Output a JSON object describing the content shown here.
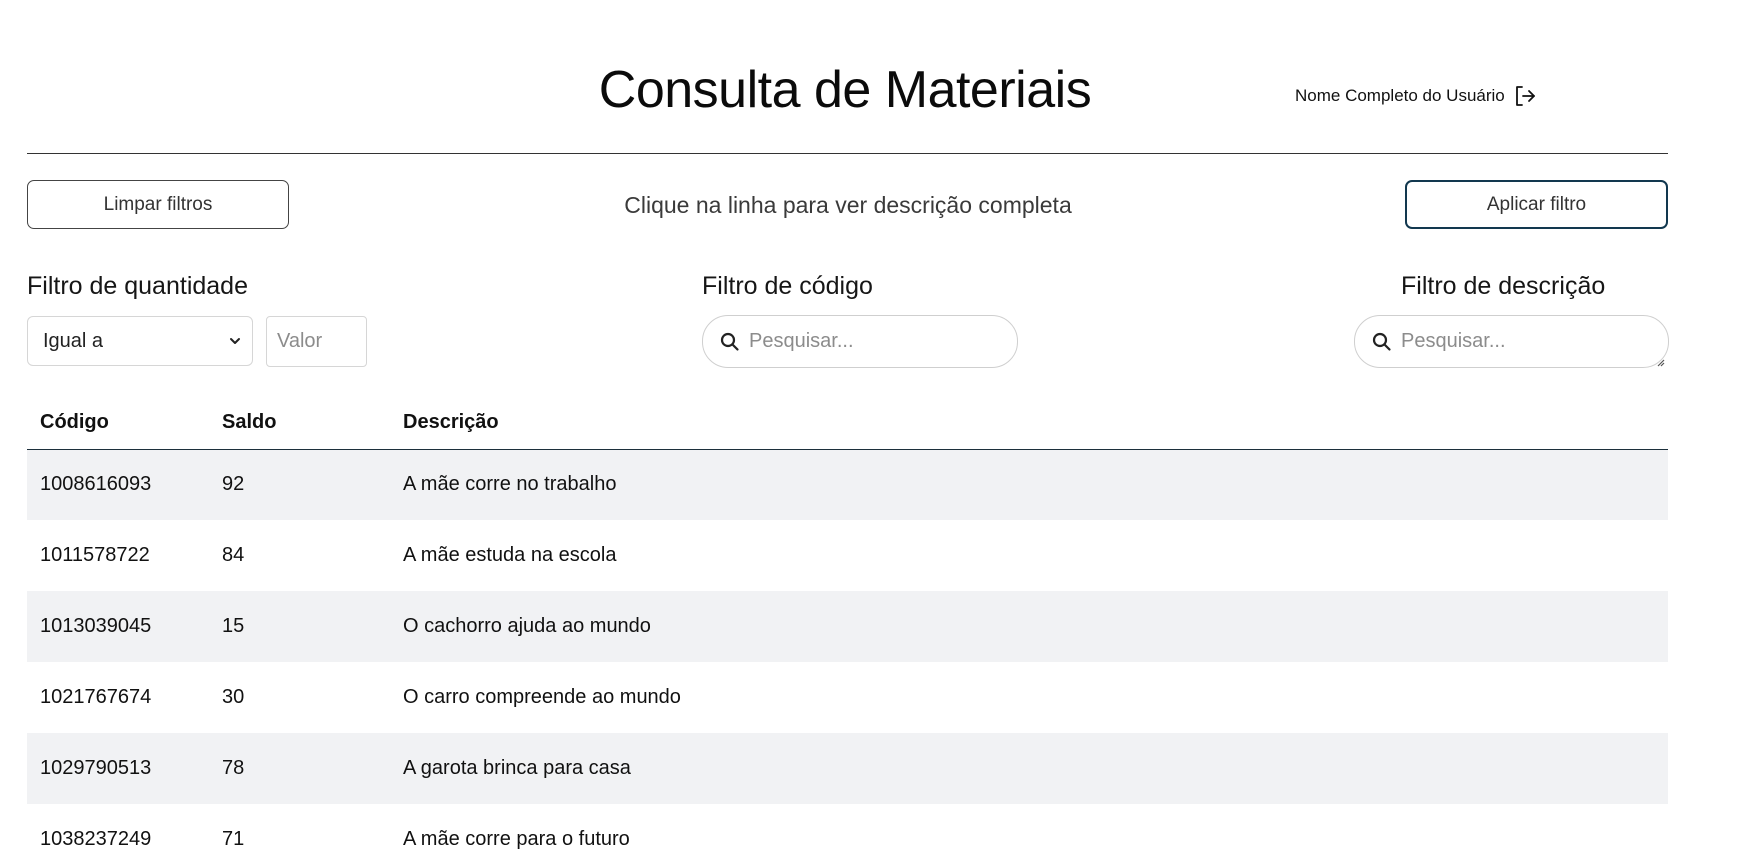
{
  "header": {
    "title": "Consulta de Materiais",
    "user_name": "Nome Completo do Usuário"
  },
  "actions": {
    "clear_label": "Limpar filtros",
    "hint": "Clique na linha para ver descrição completa",
    "apply_label": "Aplicar filtro"
  },
  "filters": {
    "quantity": {
      "label": "Filtro de quantidade",
      "operator": "Igual a",
      "value_placeholder": "Valor"
    },
    "code": {
      "label": "Filtro de código",
      "placeholder": "Pesquisar..."
    },
    "description": {
      "label": "Filtro de descrição",
      "placeholder": "Pesquisar..."
    }
  },
  "table": {
    "headers": [
      "Código",
      "Saldo",
      "Descrição"
    ],
    "rows": [
      {
        "code": "1008616093",
        "saldo": "92",
        "desc": "A mãe corre no trabalho"
      },
      {
        "code": "1011578722",
        "saldo": "84",
        "desc": "A mãe estuda na escola"
      },
      {
        "code": "1013039045",
        "saldo": "15",
        "desc": "O cachorro ajuda ao mundo"
      },
      {
        "code": "1021767674",
        "saldo": "30",
        "desc": "O carro compreende ao mundo"
      },
      {
        "code": "1029790513",
        "saldo": "78",
        "desc": "A garota brinca para casa"
      },
      {
        "code": "1038237249",
        "saldo": "71",
        "desc": "A mãe corre para o futuro"
      }
    ]
  },
  "icons": {
    "logout": "logout-icon",
    "search": "search-icon",
    "chevron": "chevron-down-icon"
  },
  "colors": {
    "apply_border": "#12384f",
    "row_stripe": "#f1f2f4"
  }
}
